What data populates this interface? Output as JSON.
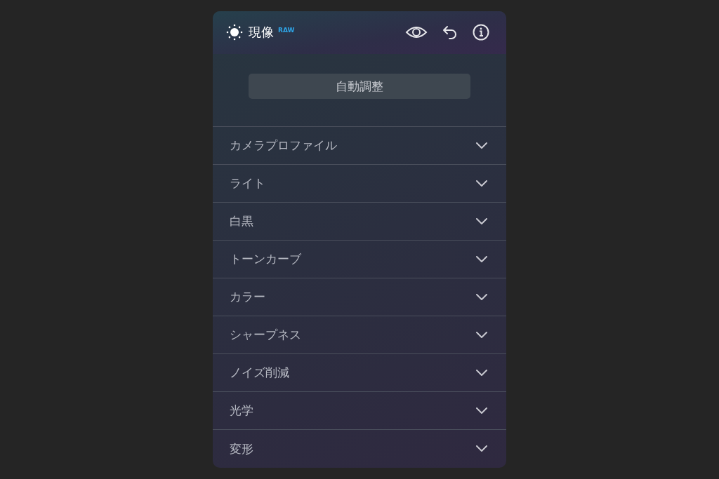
{
  "header": {
    "title": "現像",
    "badge": "RAW"
  },
  "auto_button": {
    "label": "自動調整"
  },
  "sections": [
    {
      "label": "カメラプロファイル",
      "expanded": false
    },
    {
      "label": "ライト",
      "expanded": false
    },
    {
      "label": "白黒",
      "expanded": false
    },
    {
      "label": "トーンカーブ",
      "expanded": false
    },
    {
      "label": "カラー",
      "expanded": false
    },
    {
      "label": "シャープネス",
      "expanded": false
    },
    {
      "label": "ノイズ削減",
      "expanded": false
    },
    {
      "label": "光学",
      "expanded": false
    },
    {
      "label": "変形",
      "expanded": false
    }
  ]
}
